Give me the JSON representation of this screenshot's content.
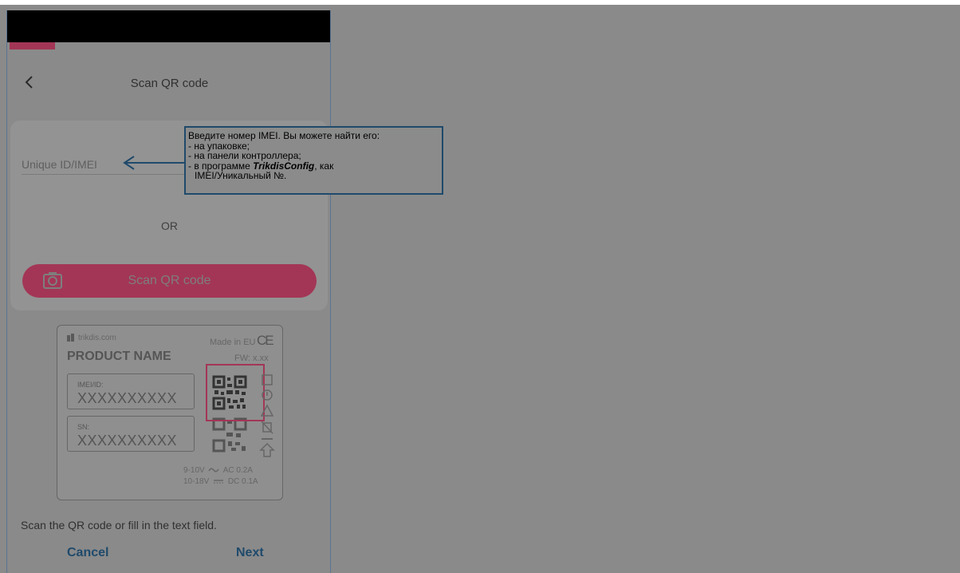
{
  "header": {
    "title": "Scan QR code"
  },
  "form": {
    "imei_placeholder": "Unique ID/IMEI",
    "imei_value": "",
    "or_label": "OR",
    "scan_button_label": "Scan QR code"
  },
  "product_label": {
    "brand": "trikdis.com",
    "made_in": "Made in EU",
    "ce_mark": "CE",
    "name": "PRODUCT NAME",
    "fw": "FW: x.xx",
    "imei_label": "IMEI/ID:",
    "imei_value": "XXXXXXXXXX",
    "sn_label": "SN:",
    "sn_value": "XXXXXXXXXX",
    "ac_voltage": "9-10V",
    "ac_current": "AC 0.2A",
    "dc_voltage": "10-18V",
    "dc_current": "DC 0.1A"
  },
  "instructions": "Scan the QR code or fill in the text field.",
  "footer": {
    "cancel_label": "Cancel",
    "next_label": "Next"
  },
  "tooltip": {
    "line1": "Введите номер IMEI. Вы можете найти его:",
    "line2": "- на упаковке;",
    "line3": "- на панели контроллера;",
    "line4_prefix": "- в программе ",
    "line4_bold": "TrikdisConfig",
    "line4_suffix": ", как",
    "line5": "IMEI/Уникальный №."
  },
  "colors": {
    "accent": "#a33656",
    "link": "#1f4a6b",
    "overlay": "#8a8a8a"
  },
  "icons": [
    "chevron-left-icon",
    "camera-icon",
    "qr-code-icon",
    "trikdis-logo-icon",
    "arrow-left-icon"
  ]
}
